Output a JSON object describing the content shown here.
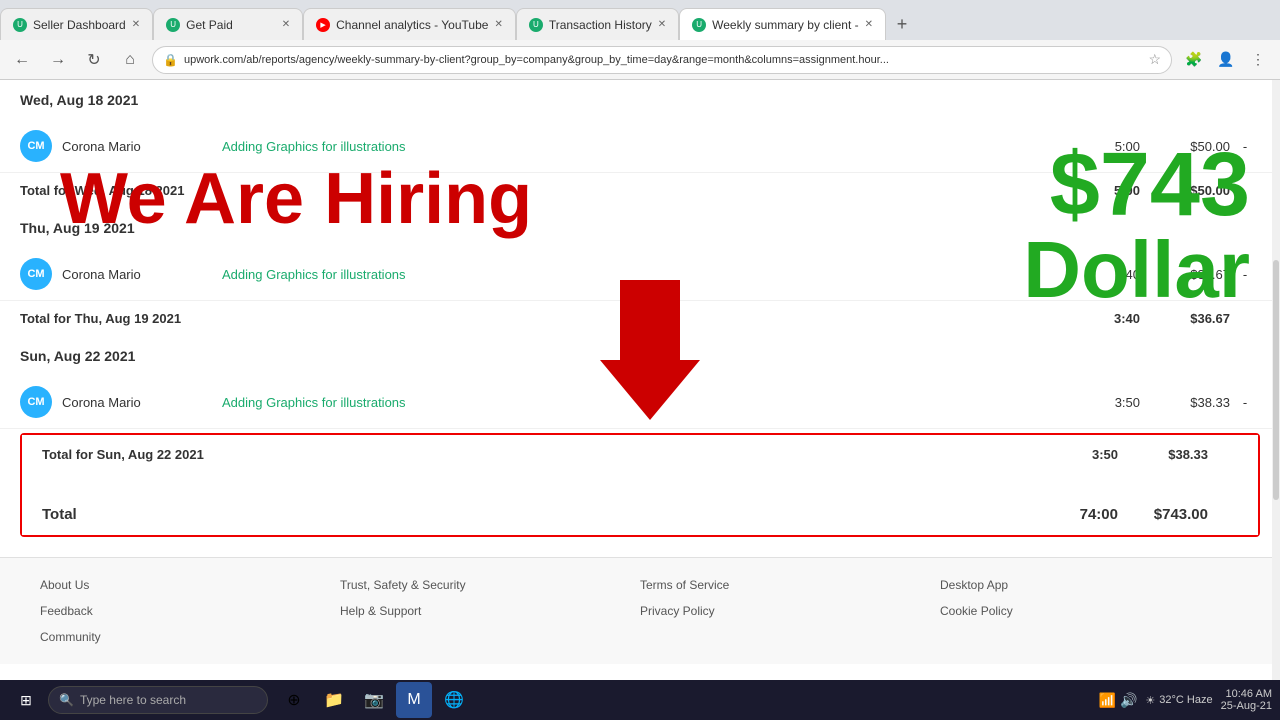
{
  "browser": {
    "tabs": [
      {
        "id": "tab1",
        "label": "Seller Dashboard",
        "favicon_color": "#1aab6d",
        "favicon_text": "U",
        "active": false
      },
      {
        "id": "tab2",
        "label": "Get Paid",
        "favicon_color": "#1aab6d",
        "favicon_text": "U",
        "active": false
      },
      {
        "id": "tab3",
        "label": "Channel analytics - YouTube",
        "favicon_color": "#ff0000",
        "favicon_text": "▶",
        "active": false
      },
      {
        "id": "tab4",
        "label": "Transaction History",
        "favicon_color": "#1aab6d",
        "favicon_text": "U",
        "active": false
      },
      {
        "id": "tab5",
        "label": "Weekly summary by client -",
        "favicon_color": "#1aab6d",
        "favicon_text": "U",
        "active": true
      }
    ],
    "address": "upwork.com/ab/reports/agency/weekly-summary-by-client?group_by=company&group_by_time=day&range=month&columns=assignment.hour...",
    "new_tab_symbol": "+"
  },
  "nav": {
    "back": "←",
    "forward": "→",
    "refresh": "↻",
    "home": "⌂"
  },
  "page": {
    "date_sections": [
      {
        "date_header": "Wed, Aug 18 2021",
        "rows": [
          {
            "avatar": "CM",
            "name": "Corona Mario",
            "task": "Adding Graphics for illustrations",
            "hours": "5:00",
            "amount": "$50.00",
            "dash": "-"
          }
        ],
        "total_label": "Total for Wed, Aug 18 2021",
        "total_hours": "5:00",
        "total_amount": "$50.00"
      },
      {
        "date_header": "Thu, Aug 19 2021",
        "rows": [
          {
            "avatar": "CM",
            "name": "Corona Mario",
            "task": "Adding Graphics for illustrations",
            "hours": "3:40",
            "amount": "$36.67",
            "dash": "-"
          }
        ],
        "total_label": "Total for Thu, Aug 19 2021",
        "total_hours": "3:40",
        "total_amount": "$36.67"
      },
      {
        "date_header": "Sun, Aug 22 2021",
        "rows": [
          {
            "avatar": "CM",
            "name": "Corona Mario",
            "task": "Adding Graphics for illustrations",
            "hours": "3:50",
            "amount": "$38.33",
            "dash": "-"
          }
        ],
        "total_label": "Total for Sun, Aug 22 2021",
        "total_hours": "3:50",
        "total_amount": "$38.33"
      }
    ],
    "grand_total_label": "Total",
    "grand_total_hours": "74:00",
    "grand_total_amount": "$743.00"
  },
  "promo": {
    "line1": "We Are Hiring",
    "dollar": "$743",
    "dollar_label": "Dollar"
  },
  "footer": {
    "col1": [
      "About Us",
      "Feedback",
      "Community"
    ],
    "col2": [
      "Trust, Safety & Security",
      "Help & Support",
      ""
    ],
    "col3": [
      "Terms of Service",
      "Privacy Policy",
      ""
    ],
    "col4": [
      "Desktop App",
      "Cookie Policy",
      ""
    ]
  },
  "taskbar": {
    "search_placeholder": "Type here to search",
    "weather": "32°C Haze",
    "time": "10:46 AM",
    "date": "25-Aug-21"
  }
}
